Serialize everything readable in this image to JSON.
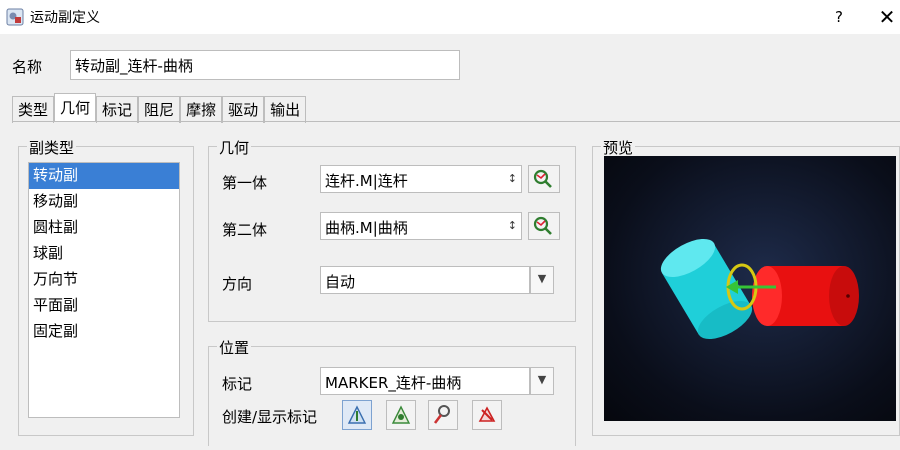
{
  "window": {
    "title": "运动副定义",
    "help": "?",
    "close": "✕"
  },
  "name": {
    "label": "名称",
    "value": "转动副_连杆-曲柄"
  },
  "tabs": [
    "类型",
    "几何",
    "标记",
    "阻尼",
    "摩擦",
    "驱动",
    "输出"
  ],
  "active_tab": "几何",
  "joint_type": {
    "legend": "副类型",
    "items": [
      "转动副",
      "移动副",
      "圆柱副",
      "球副",
      "万向节",
      "平面副",
      "固定副"
    ],
    "selected": "转动副"
  },
  "geometry": {
    "legend": "几何",
    "first_body_label": "第一体",
    "first_body_value": "连杆.M|连杆",
    "second_body_label": "第二体",
    "second_body_value": "曲柄.M|曲柄",
    "direction_label": "方向",
    "direction_value": "自动"
  },
  "position": {
    "legend": "位置",
    "marker_label": "标记",
    "marker_value": "MARKER_连杆-曲柄",
    "create_label": "创建/显示标记"
  },
  "preview": {
    "legend": "预览"
  },
  "colors": {
    "selection": "#3a7fd5",
    "cylinder_cyan": "#22d3dd",
    "cylinder_red": "#ee1111",
    "axis_green": "#36c436"
  },
  "icons": [
    "app-icon",
    "pick-body-icon",
    "create-marker-icon",
    "show-marker-icon",
    "edit-marker-icon",
    "delete-marker-icon"
  ]
}
